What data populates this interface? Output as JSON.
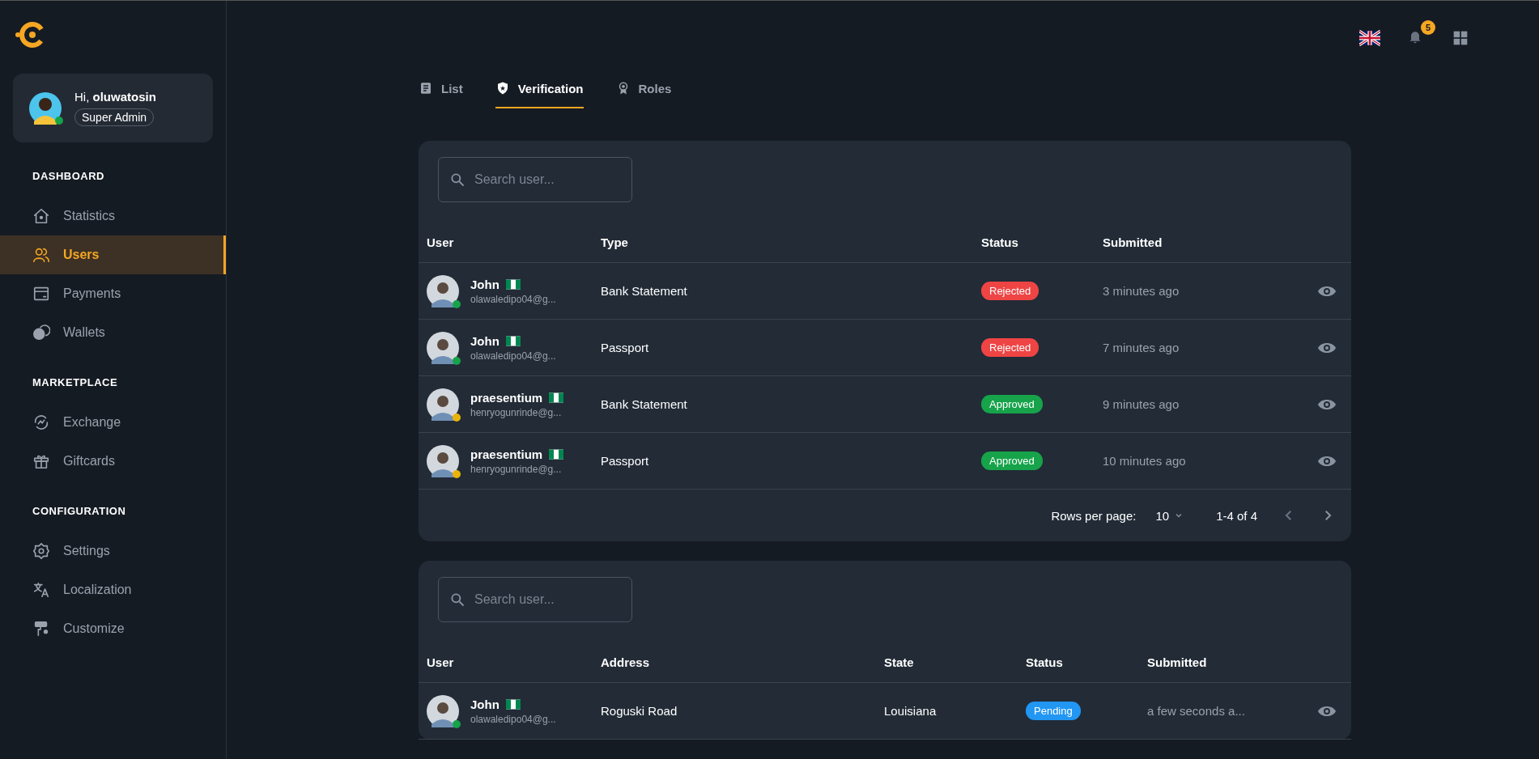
{
  "sidebar": {
    "user": {
      "greeting": "Hi, **oluwatosin**",
      "role": "Super Admin",
      "online": true
    },
    "sections": [
      {
        "title": "DASHBOARD",
        "items": [
          {
            "label": "Statistics",
            "selected": false
          },
          {
            "label": "Users",
            "selected": true
          },
          {
            "label": "Payments",
            "selected": false
          },
          {
            "label": "Wallets",
            "selected": false
          }
        ]
      },
      {
        "title": "MARKETPLACE",
        "items": [
          {
            "label": "Exchange",
            "selected": false
          },
          {
            "label": "Giftcards",
            "selected": false
          }
        ]
      },
      {
        "title": "CONFIGURATION",
        "items": [
          {
            "label": "Settings",
            "selected": false
          },
          {
            "label": "Localization",
            "selected": false
          },
          {
            "label": "Customize",
            "selected": false
          }
        ]
      }
    ]
  },
  "header": {
    "notification_count": "5"
  },
  "tabs": [
    {
      "label": "List",
      "selected": false
    },
    {
      "label": "Verification",
      "selected": true
    },
    {
      "label": "Roles",
      "selected": false
    }
  ],
  "tables": [
    {
      "search": {
        "placeholder": "Search user..."
      },
      "columns": [
        "User",
        "Type",
        "Status",
        "Submitted"
      ],
      "rows": [
        {
          "user": {
            "name": "John",
            "email": "olawaledipo04@g...",
            "color": "#16a34a"
          },
          "type": "Bank Statement",
          "status": {
            "label": "Rejected",
            "color": "#ef4444"
          },
          "submitted": "3 minutes ago"
        },
        {
          "user": {
            "name": "John",
            "email": "olawaledipo04@g...",
            "color": "#16a34a"
          },
          "type": "Passport",
          "status": {
            "label": "Rejected",
            "color": "#ef4444"
          },
          "submitted": "7 minutes ago"
        },
        {
          "user": {
            "name": "praesentium",
            "email": "henryogunrinde@g...",
            "color": "#eab308"
          },
          "type": "Bank Statement",
          "status": {
            "label": "Approved",
            "color": "#16a34a"
          },
          "submitted": "9 minutes ago"
        },
        {
          "user": {
            "name": "praesentium",
            "email": "henryogunrinde@g...",
            "color": "#eab308"
          },
          "type": "Passport",
          "status": {
            "label": "Approved",
            "color": "#16a34a"
          },
          "submitted": "10 minutes ago"
        }
      ],
      "pagination": {
        "label": "Rows per page:",
        "rows_per_page": "10",
        "range": "1-4 of 4"
      }
    },
    {
      "search": {
        "placeholder": "Search user..."
      },
      "columns": [
        "User",
        "Address",
        "State",
        "Status",
        "Submitted"
      ],
      "rows": [
        {
          "user": {
            "name": "John",
            "email": "olawaledipo04@g...",
            "color": "#16a34a"
          },
          "address": "Roguski Road",
          "state": "Louisiana",
          "status": {
            "label": "Pending",
            "color": "#2196f3"
          },
          "submitted": "a few seconds a..."
        }
      ]
    }
  ]
}
